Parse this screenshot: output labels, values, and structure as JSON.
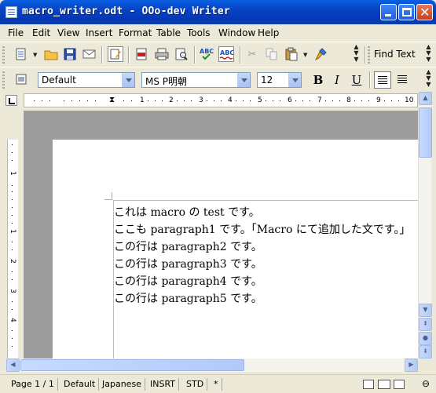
{
  "window": {
    "title": "macro_writer.odt - OOo-dev Writer"
  },
  "menu": [
    "File",
    "Edit",
    "View",
    "Insert",
    "Format",
    "Table",
    "Tools",
    "Window",
    "Help"
  ],
  "toolbar": {
    "find_text_label": "Find Text",
    "icons": [
      "new-document",
      "open-folder",
      "save",
      "email",
      "edit-mode",
      "export-pdf",
      "print",
      "print-preview",
      "spellcheck",
      "auto-spellcheck",
      "cut",
      "copy",
      "paste",
      "format-paintbrush"
    ]
  },
  "formatting": {
    "paragraph_style": "Default",
    "font_name": "MS P明朝",
    "font_size": "12",
    "bold_label": "B",
    "italic_label": "I",
    "underline_label": "U"
  },
  "ruler": {
    "h_ticks": [
      "1",
      "2",
      "3",
      "4",
      "5",
      "6",
      "7",
      "8",
      "9",
      "10"
    ],
    "v_ticks": [
      "1",
      "1",
      "2",
      "3",
      "4"
    ]
  },
  "document": {
    "lines": [
      "これは macro の test です。",
      "ここも paragraph1 です。「Macro にて追加した文です。」",
      "この行は paragraph2 です。",
      "この行は paragraph3 です。",
      "この行は paragraph4 です。",
      "この行は paragraph5 です。"
    ]
  },
  "statusbar": {
    "page": "Page 1 / 1",
    "style": "Default",
    "language": "Japanese",
    "insert_mode": "INSRT",
    "selection_mode": "STD",
    "modified": "*"
  },
  "colors": {
    "titlebar": "#0743c3",
    "chrome": "#ece9d8",
    "workspace": "#9c9c9c",
    "page": "#ffffff"
  }
}
